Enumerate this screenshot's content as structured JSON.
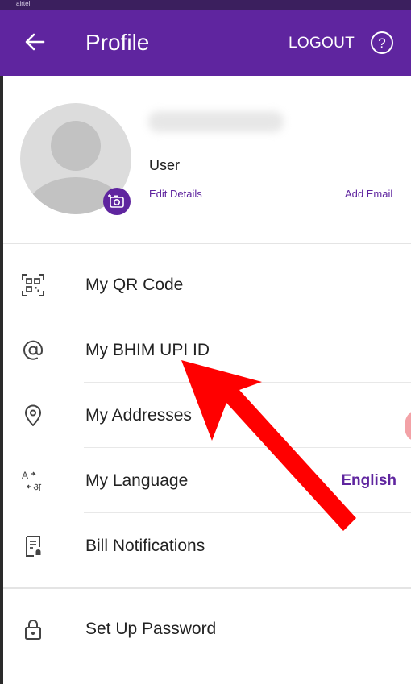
{
  "status_bar": {
    "carrier": "airtel"
  },
  "header": {
    "title": "Profile",
    "logout_label": "LOGOUT",
    "back_icon": "arrow-left-icon",
    "help_icon": "help-circle-icon"
  },
  "profile": {
    "name": "User",
    "edit_details_label": "Edit Details",
    "add_email_label": "Add Email",
    "avatar_icon": "default-avatar",
    "camera_icon": "camera-icon"
  },
  "menu": {
    "items": [
      {
        "label": "My QR Code",
        "icon": "qr-code-icon"
      },
      {
        "label": "My BHIM UPI ID",
        "icon": "at-sign-icon"
      },
      {
        "label": "My Addresses",
        "icon": "location-pin-icon"
      },
      {
        "label": "My Language",
        "icon": "language-icon",
        "value": "English"
      },
      {
        "label": "Bill Notifications",
        "icon": "bill-notification-icon"
      },
      {
        "label": "Set Up Password",
        "icon": "lock-icon"
      }
    ]
  },
  "colors": {
    "brand": "#5f259f",
    "annotation_arrow": "#ff0000"
  }
}
